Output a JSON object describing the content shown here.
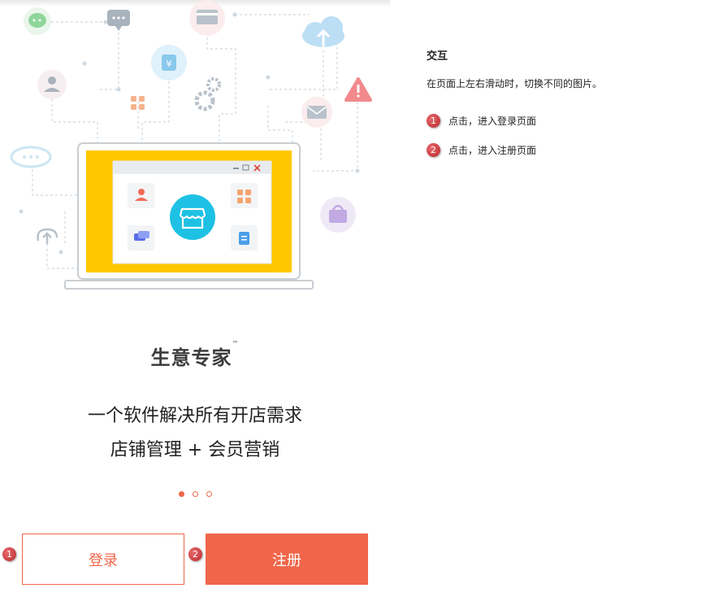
{
  "brand": {
    "name": "生意专家",
    "tm": "™"
  },
  "taglines": [
    "一个软件解决所有开店需求",
    "店铺管理 + 会员营销"
  ],
  "carousel": {
    "pages": 3,
    "active_index": 0
  },
  "buttons": {
    "login": "登录",
    "register": "注册"
  },
  "markers": {
    "login": "1",
    "register": "2"
  },
  "notes": {
    "title": "交互",
    "description": "在页面上左右滑动时，切换不同的图片。",
    "items": [
      {
        "num": "1",
        "text": "点击，进入登录页面"
      },
      {
        "num": "2",
        "text": "点击，进入注册页面"
      }
    ]
  },
  "colors": {
    "accent": "#f0664a",
    "laptop_screen": "#ffc700",
    "store_icon": "#1ec1e4"
  }
}
